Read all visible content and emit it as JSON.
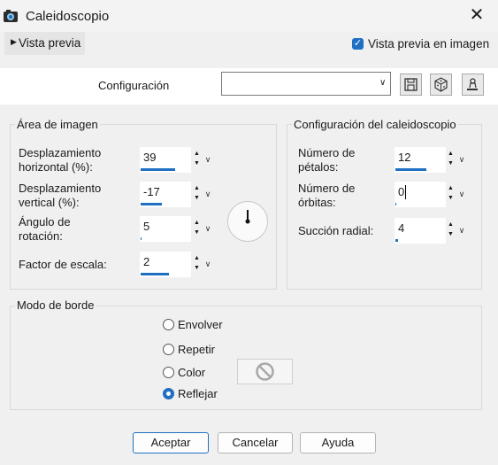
{
  "window": {
    "title": "Caleidoscopio",
    "close": "✕"
  },
  "toolbar": {
    "preview_toggle": "Vista previa",
    "preview_in_image": "Vista previa en imagen",
    "preview_in_image_checked": true
  },
  "config": {
    "label": "Configuración",
    "selected": ""
  },
  "image_area": {
    "legend": "Área de imagen",
    "fields": [
      {
        "label1": "Desplazamiento",
        "label2": "horizontal (%):",
        "value": "39",
        "fill": 0.7
      },
      {
        "label1": "Desplazamiento",
        "label2": "vertical (%):",
        "value": "-17",
        "fill": 0.42
      },
      {
        "label1": "Ángulo de",
        "label2": "rotación:",
        "value": "5",
        "fill": 0.02
      },
      {
        "label1": "Factor de escala:",
        "label2": "",
        "value": "2",
        "fill": 0.58
      }
    ]
  },
  "kaleido_config": {
    "legend": "Configuración del caleidoscopio",
    "fields": [
      {
        "label1": "Número de",
        "label2": "pétalos:",
        "value": "12",
        "fill": 0.62
      },
      {
        "label1": "Número de",
        "label2": "órbitas:",
        "value": "0",
        "fill": 0.0
      },
      {
        "label1": "Succión radial:",
        "label2": "",
        "value": "4",
        "fill": 0.05
      }
    ]
  },
  "border_mode": {
    "legend": "Modo de borde",
    "options": [
      {
        "label": "Envolver",
        "selected": false
      },
      {
        "label": "Repetir",
        "selected": false
      },
      {
        "label": "Color",
        "selected": false
      },
      {
        "label": "Reflejar",
        "selected": true
      }
    ]
  },
  "buttons": {
    "accept": "Aceptar",
    "cancel": "Cancelar",
    "help": "Ayuda"
  },
  "colors": {
    "accent": "#1f6fc2",
    "background": "#f0f0f0"
  }
}
